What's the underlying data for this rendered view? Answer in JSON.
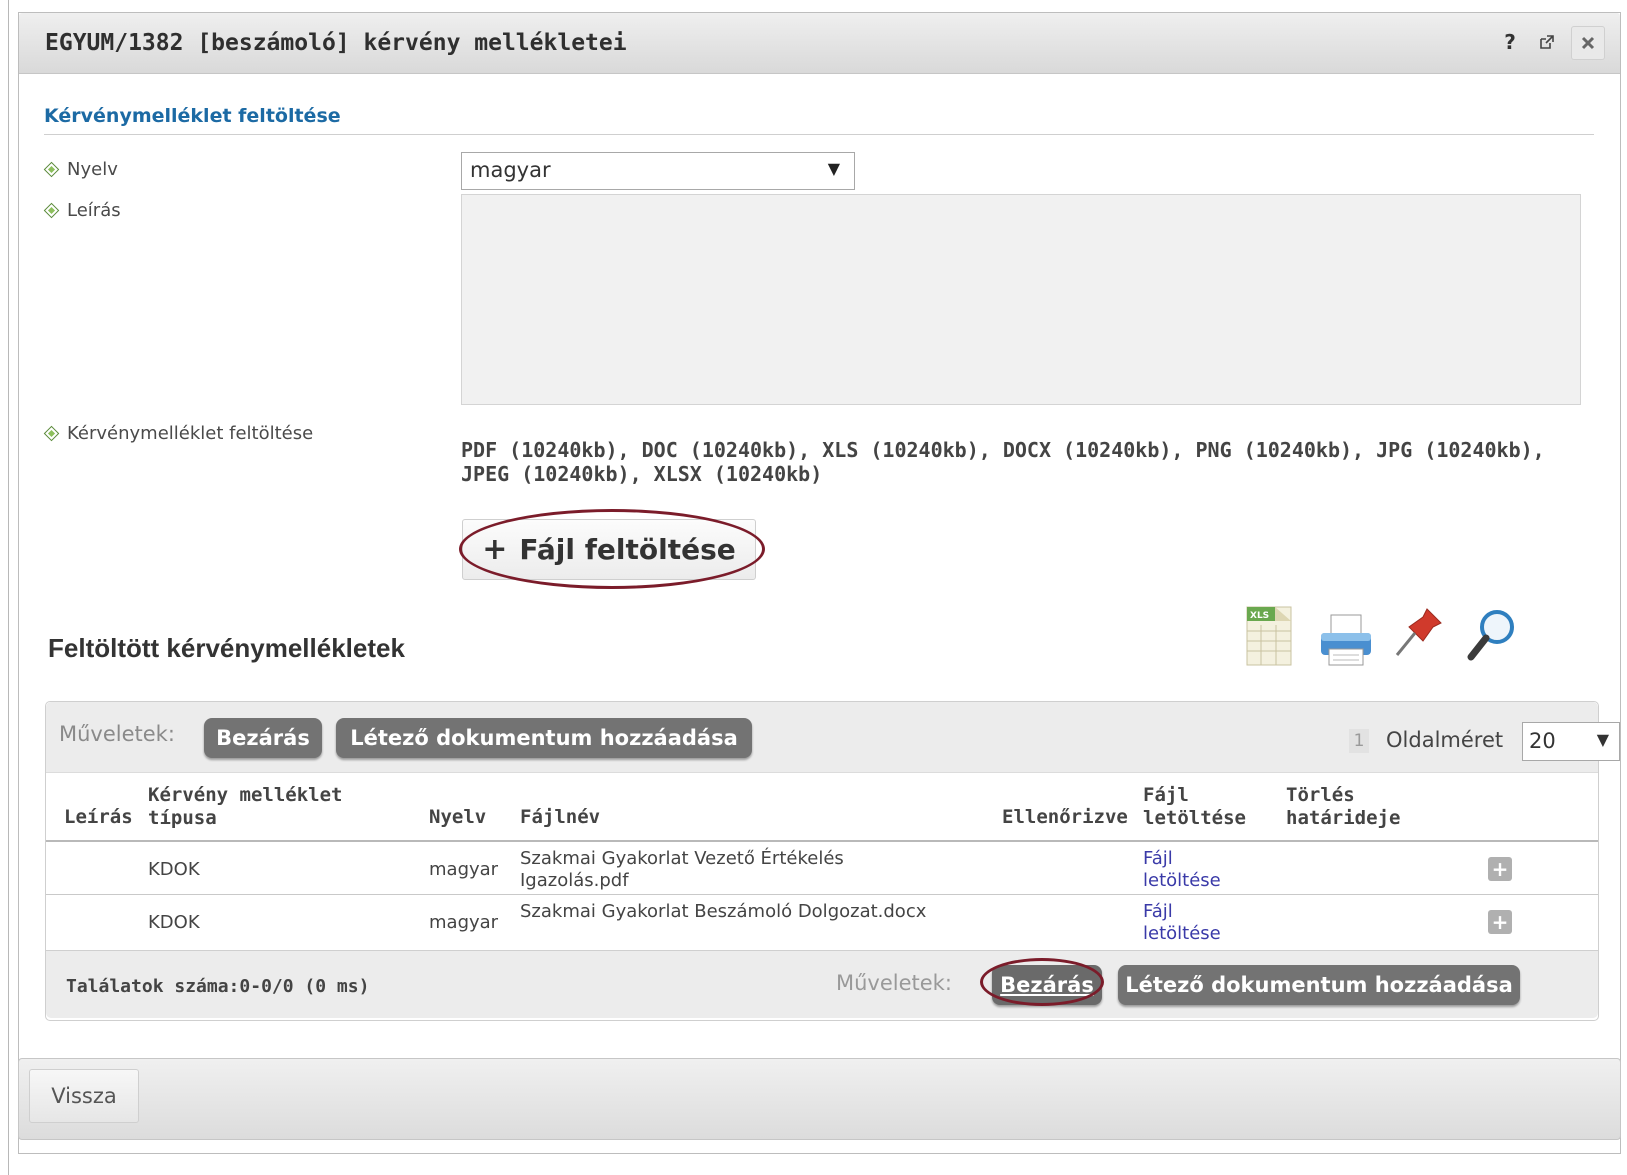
{
  "dialog": {
    "title": "EGYUM/1382 [beszámoló] kérvény mellékletei",
    "help_icon": "?",
    "popout_icon": "popout-icon",
    "close_icon": "close-icon"
  },
  "upload_section": {
    "title": "Kérvénymelléklet feltöltése",
    "language_label": "Nyelv",
    "language_value": "magyar",
    "description_label": "Leírás",
    "description_value": "",
    "file_label": "Kérvénymelléklet feltöltése",
    "allowed_types": "PDF (10240kb), DOC (10240kb), XLS (10240kb), DOCX (10240kb), PNG (10240kb), JPG (10240kb), JPEG (10240kb), XLSX (10240kb)",
    "upload_button_label": "Fájl feltöltése",
    "upload_button_icon": "plus-icon"
  },
  "uploaded": {
    "title": "Feltöltött kérvénymellékletek",
    "tools": [
      "xls-export-icon",
      "print-icon",
      "pin-icon",
      "search-icon"
    ],
    "toolbar": {
      "ops_label": "Műveletek:",
      "close_label": "Bezárás",
      "add_existing_label": "Létező dokumentum hozzáadása",
      "page_number": "1",
      "page_size_label": "Oldalméret",
      "page_size_value": "20"
    },
    "columns": {
      "leiras": "Leírás",
      "tipus": "Kérvény melléklet típusa",
      "nyelv": "Nyelv",
      "fajlnev": "Fájlnév",
      "ellenorizve": "Ellenőrizve",
      "letoltes": "Fájl letöltése",
      "torles": "Törlés határideje"
    },
    "rows": [
      {
        "leiras": "",
        "tipus": "KDOK",
        "nyelv": "magyar",
        "fajlnev": "Szakmai Gyakorlat Vezető Értékelés Igazolás.pdf",
        "ellenorizve": "",
        "letoltes": "Fájl letöltése",
        "torles": ""
      },
      {
        "leiras": "",
        "tipus": "KDOK",
        "nyelv": "magyar",
        "fajlnev": "Szakmai Gyakorlat Beszámoló Dolgozat.docx",
        "ellenorizve": "",
        "letoltes": "Fájl letöltése",
        "torles": ""
      }
    ],
    "footer": {
      "hits": "Találatok száma:0-0/0 (0 ms)",
      "ops_label": "Műveletek:",
      "close_label": "Bezárás",
      "add_existing_label": "Létező dokumentum hozzáadása"
    }
  },
  "bottom": {
    "back_label": "Vissza"
  },
  "colors": {
    "accent_blue": "#1c6aa4",
    "pill_gray": "#737373",
    "highlight_ring": "#7b1c2a",
    "link": "#3a3aa8"
  }
}
